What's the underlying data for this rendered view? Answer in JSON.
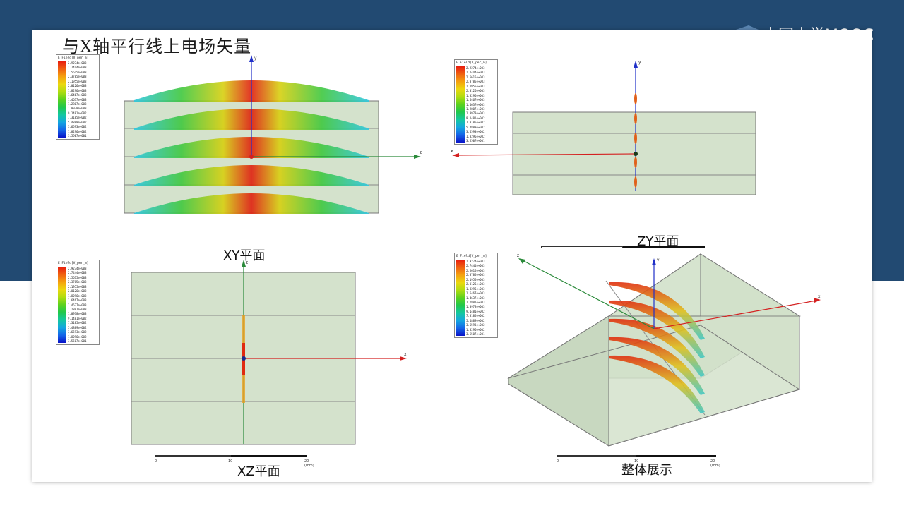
{
  "slide": {
    "title": "与X轴平行线上电场矢量",
    "logo": "中国大学MOOC"
  },
  "legend": {
    "title": "E Field[V_per_m]",
    "values": [
      "2.9274e+003",
      "2.7444e+003",
      "2.5615e+003",
      "2.3785e+003",
      "2.1955e+003",
      "2.0126e+003",
      "1.8296e+003",
      "1.6467e+003",
      "1.4637e+003",
      "1.2807e+003",
      "1.0978e+003",
      "9.1481e+002",
      "7.3185e+002",
      "5.4889e+002",
      "3.6593e+002",
      "1.8296e+002",
      "3.5507e+001"
    ]
  },
  "panels": {
    "xy": {
      "label": "XY平面"
    },
    "xz": {
      "label": "XZ平面",
      "scale": {
        "ticks": [
          "0",
          "10",
          "20 (mm)"
        ]
      }
    },
    "zy": {
      "label": "ZY平面"
    },
    "whole": {
      "label": "整体展示",
      "scale": {
        "ticks": [
          "0",
          "10",
          "20 (mm)"
        ]
      }
    }
  },
  "axes": {
    "x": "x",
    "y": "y",
    "z": "z"
  },
  "colors": {
    "frame_blue": "#224a72",
    "box_fill": "#d4e2cc",
    "x_axis": "#d42020",
    "y_axis": "#2030c8",
    "z_axis": "#209020"
  }
}
